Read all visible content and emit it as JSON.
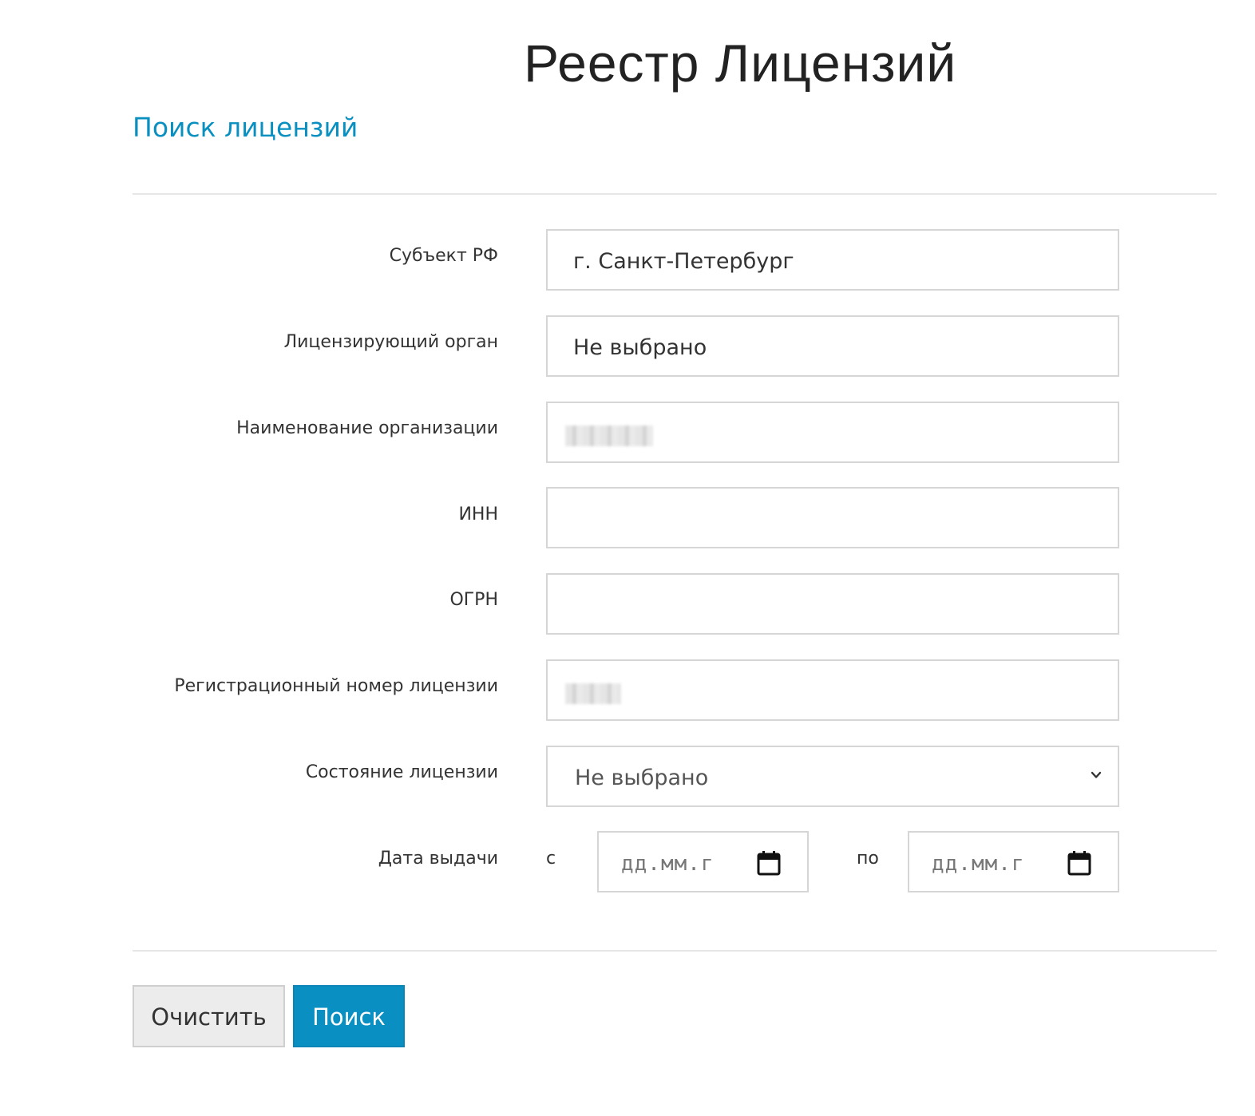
{
  "page": {
    "title": "Реестр Лицензий",
    "section_title": "Поиск лицензий"
  },
  "form": {
    "subject": {
      "label": "Субъект РФ",
      "value": "г. Санкт-Петербург"
    },
    "licensing_body": {
      "label": "Лицензирующий орган",
      "value": "Не выбрано"
    },
    "organization_name": {
      "label": "Наименование организации",
      "value_redacted": true
    },
    "inn": {
      "label": "ИНН",
      "value": ""
    },
    "ogrn": {
      "label": "ОГРН",
      "value": ""
    },
    "registration_number": {
      "label": "Регистрационный номер лицензии",
      "value_redacted": true
    },
    "license_state": {
      "label": "Состояние лицензии",
      "selected": "Не выбрано"
    },
    "issue_date": {
      "label": "Дата выдачи",
      "from_label": "с",
      "to_label": "по",
      "from_placeholder": "дд.мм.г",
      "to_placeholder": "дд.мм.г"
    }
  },
  "buttons": {
    "clear": "Очистить",
    "search": "Поиск"
  },
  "colors": {
    "accent": "#0a8fc2",
    "section_title": "#0a90c0",
    "border": "#d6d6d6"
  },
  "icons": {
    "select_chevron": "chevron-down-icon",
    "date_picker": "calendar-icon"
  }
}
